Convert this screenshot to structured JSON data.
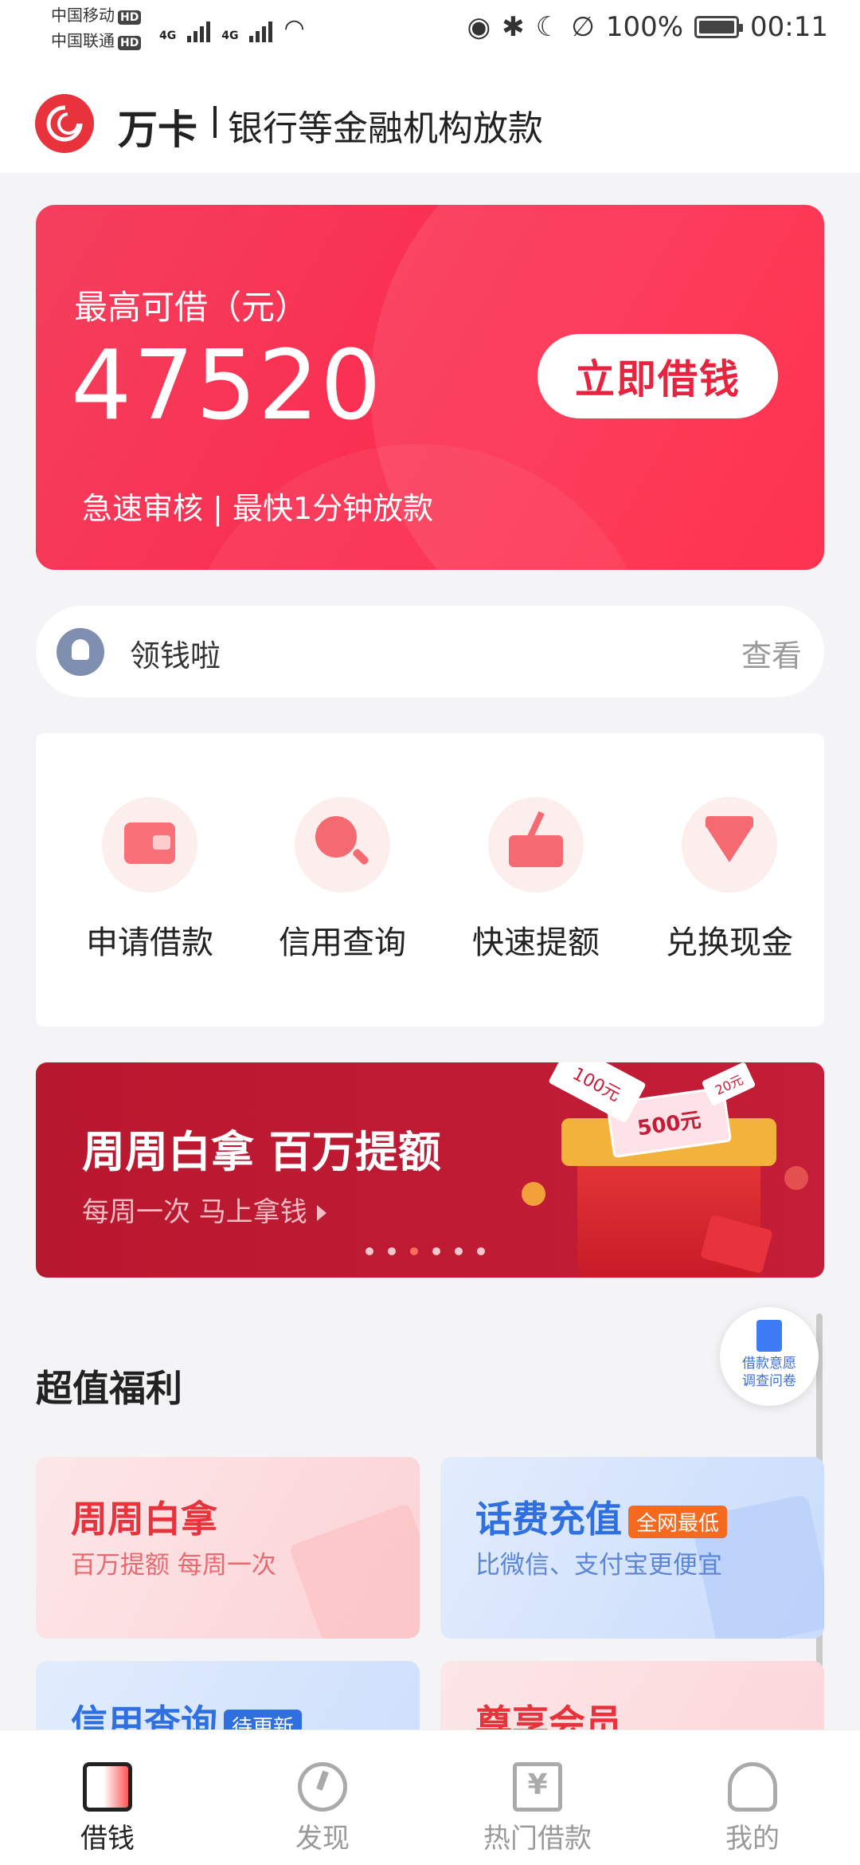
{
  "status_bar": {
    "carrier1": "中国移动",
    "carrier2": "中国联通",
    "hd": "HD",
    "net": "4G",
    "battery": "100%",
    "time": "00:11"
  },
  "header": {
    "brand": "万卡",
    "slogan": "银行等金融机构放款"
  },
  "hero": {
    "label": "最高可借（元）",
    "amount": "47520",
    "button": "立即借钱",
    "subtitle": "急速审核 | 最快1分钟放款"
  },
  "notice": {
    "text": "领钱啦",
    "link": "查看"
  },
  "quick_actions": [
    {
      "label": "申请借款",
      "icon": "wallet-icon"
    },
    {
      "label": "信用查询",
      "icon": "magnifier-icon"
    },
    {
      "label": "快速提额",
      "icon": "upload-tray-icon"
    },
    {
      "label": "兑换现金",
      "icon": "diamond-icon"
    }
  ],
  "banner": {
    "title": "周周白拿 百万提额",
    "subtitle": "每周一次  马上拿钱",
    "note_500": "500元",
    "note_100": "100元",
    "note_20": "20元",
    "active_dot": 2,
    "dot_count": 6
  },
  "survey": {
    "line1": "借款意愿",
    "line2": "调查问卷"
  },
  "benefits": {
    "title": "超值福利",
    "cards": [
      {
        "title": "周周白拿",
        "subtitle": "百万提额 每周一次",
        "tag": "",
        "color": "#e8323c"
      },
      {
        "title": "话费充值",
        "subtitle": "比微信、支付宝更便宜",
        "tag": "全网最低",
        "color": "#2f6fe0"
      },
      {
        "title": "信用查询",
        "subtitle": "",
        "tag": "待更新",
        "color": "#2f6fe0"
      },
      {
        "title": "尊享会员",
        "subtitle": "",
        "tag": "",
        "color": "#e8323c"
      }
    ]
  },
  "bottom_nav": [
    {
      "label": "借钱",
      "icon": "wallet-icon",
      "active": true
    },
    {
      "label": "发现",
      "icon": "compass-icon",
      "active": false
    },
    {
      "label": "热门借款",
      "icon": "yen-bag-icon",
      "active": false
    },
    {
      "label": "我的",
      "icon": "user-icon",
      "active": false
    }
  ],
  "colors": {
    "brand_red": "#e8323c",
    "accent_blue": "#2f6fe0"
  }
}
